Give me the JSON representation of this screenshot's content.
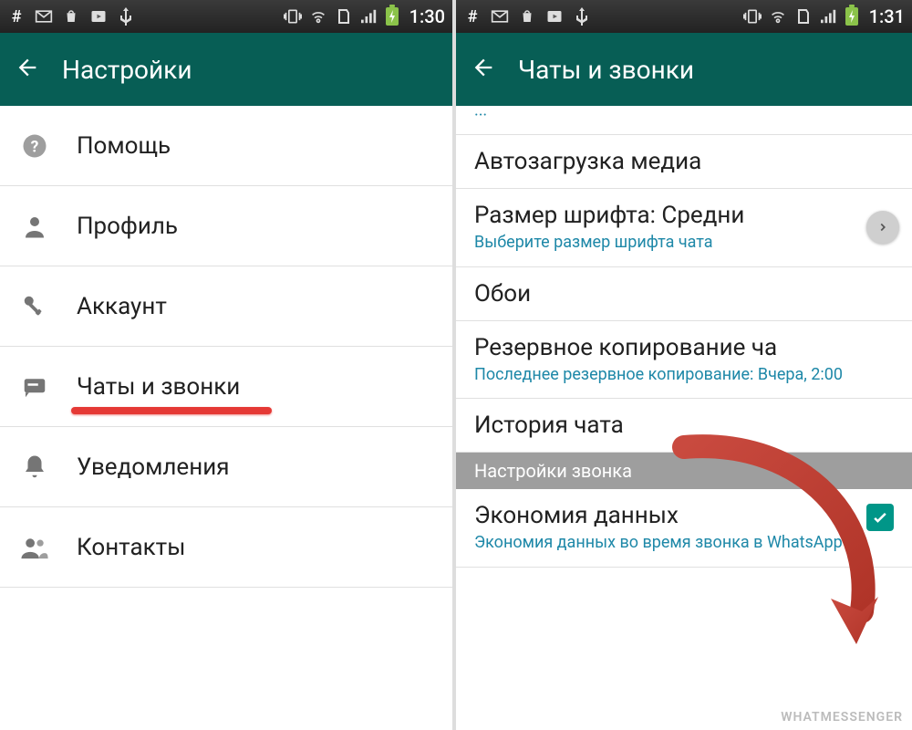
{
  "left": {
    "status_time": "1:30",
    "appbar_title": "Настройки",
    "items": [
      {
        "label": "Помощь"
      },
      {
        "label": "Профиль"
      },
      {
        "label": "Аккаунт"
      },
      {
        "label": "Чаты и звонки"
      },
      {
        "label": "Уведомления"
      },
      {
        "label": "Контакты"
      }
    ]
  },
  "right": {
    "status_time": "1:31",
    "appbar_title": "Чаты и звонки",
    "rows": {
      "media": {
        "title": "Автозагрузка медиа"
      },
      "font": {
        "title": "Размер шрифта: Средни",
        "sub": "Выберите размер шрифта чата"
      },
      "wallpaper": {
        "title": "Обои"
      },
      "backup": {
        "title": "Резервное копирование ча",
        "sub": "Последнее резервное копирование: Вчера, 2:00"
      },
      "history": {
        "title": "История чата"
      },
      "section": "Настройки звонка",
      "datasave": {
        "title": "Экономия данных",
        "sub": "Экономия данных во время звонка в WhatsApp"
      }
    },
    "watermark": "WHATMESSENGER"
  }
}
